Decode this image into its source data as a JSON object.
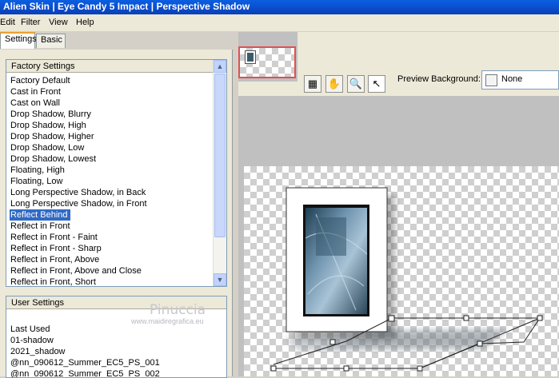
{
  "window": {
    "title": "Alien Skin  |  Eye Candy 5 Impact  |  Perspective Shadow"
  },
  "menu": [
    "Edit",
    "Filter",
    "View",
    "Help"
  ],
  "tabs": [
    "Settings",
    "Basic"
  ],
  "factory": {
    "header": "Factory Settings",
    "items": [
      "Factory Default",
      "Cast in Front",
      "Cast on Wall",
      "Drop Shadow, Blurry",
      "Drop Shadow, High",
      "Drop Shadow, Higher",
      "Drop Shadow, Low",
      "Drop Shadow, Lowest",
      "Floating, High",
      "Floating, Low",
      "Long Perspective Shadow, in Back",
      "Long Perspective Shadow, in Front",
      "Reflect Behind",
      "Reflect in Front",
      "Reflect in Front - Faint",
      "Reflect in Front - Sharp",
      "Reflect in Front, Above",
      "Reflect in Front, Above and Close",
      "Reflect in Front, Short"
    ],
    "selected": "Reflect Behind"
  },
  "user": {
    "header": "User Settings",
    "items": [
      "Last Used",
      "01-shadow",
      "2021_shadow",
      "@nn_090612_Summer_EC5_PS_001",
      "@nn_090612_Summer_EC5_PS_002"
    ]
  },
  "toolbar": {
    "preview_bg_label": "Preview Background:",
    "preview_bg_value": "None",
    "tools": [
      "preview-toggle-icon",
      "hand-icon",
      "zoom-icon",
      "arrow-icon"
    ]
  },
  "watermark": {
    "name": "Pinuccia",
    "site": "www.maidiregrafica.eu"
  },
  "colors": {
    "selection": "#316ac5",
    "titlebar": "#0a4fd0",
    "thumb_border": "#e05050"
  }
}
